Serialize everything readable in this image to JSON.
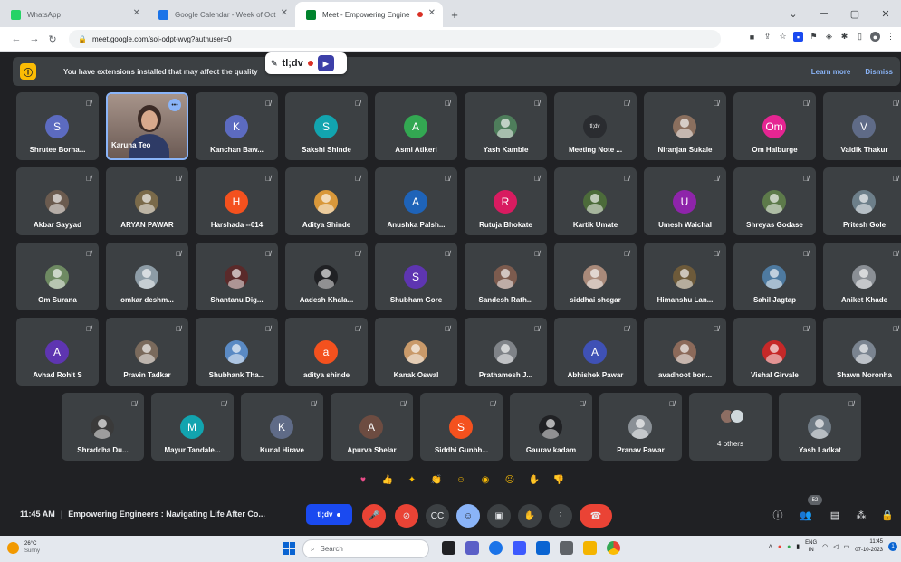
{
  "browser": {
    "tabs": [
      {
        "title": "WhatsApp",
        "favicon_color": "#25d366",
        "active": false
      },
      {
        "title": "Google Calendar - Week of Oct",
        "favicon_color": "#1a73e8",
        "active": false
      },
      {
        "title": "Meet - Empowering Engine",
        "favicon_color": "#00832d",
        "active": true
      }
    ],
    "new_tab": "+",
    "url": "meet.google.com/soi-odpt-wvg?authuser=0"
  },
  "banner": {
    "message": "You have extensions installed that may affect the quality",
    "learn_more": "Learn more",
    "dismiss": "Dismiss"
  },
  "tldv_overlay": {
    "label": "tl;dv"
  },
  "participants": [
    [
      {
        "name": "Shrutee Borha...",
        "initial": "S",
        "color": "#5c6bc0",
        "type": "initial"
      },
      {
        "name": "Karuna Teo",
        "type": "video",
        "self": true
      },
      {
        "name": "Kanchan Baw...",
        "initial": "K",
        "color": "#5c6bc0",
        "type": "initial"
      },
      {
        "name": "Sakshi Shinde",
        "initial": "S",
        "color": "#12a4af",
        "type": "initial"
      },
      {
        "name": "Asmi Atikeri",
        "initial": "A",
        "color": "#33a852",
        "type": "initial"
      },
      {
        "name": "Yash Kamble",
        "color": "#4e7d5b",
        "type": "photo"
      },
      {
        "name": "Meeting Note ...",
        "initial": "tl;dv",
        "color": "#2a2c30",
        "type": "initial"
      },
      {
        "name": "Niranjan Sukale",
        "color": "#8a6f5e",
        "type": "photo"
      },
      {
        "name": "Om Halburge",
        "initial": "Om",
        "color": "#e52592",
        "type": "initial"
      },
      {
        "name": "Vaidik Thakur",
        "initial": "V",
        "color": "#5f6b87",
        "type": "initial"
      }
    ],
    [
      {
        "name": "Akbar Sayyad",
        "color": "#6b5b4f",
        "type": "photo"
      },
      {
        "name": "ARYAN PAWAR",
        "color": "#7a6a4a",
        "type": "photo"
      },
      {
        "name": "Harshada --014",
        "initial": "H",
        "color": "#f4511e",
        "type": "initial"
      },
      {
        "name": "Aditya Shinde",
        "color": "#d9983a",
        "type": "photo"
      },
      {
        "name": "Anushka Palsh...",
        "initial": "A",
        "color": "#1e63b8",
        "type": "initial"
      },
      {
        "name": "Rutuja Bhokate",
        "initial": "R",
        "color": "#d81b60",
        "type": "initial"
      },
      {
        "name": "Kartik Umate",
        "color": "#4c6b3a",
        "type": "photo"
      },
      {
        "name": "Umesh Waichal",
        "initial": "U",
        "color": "#8e24aa",
        "type": "initial"
      },
      {
        "name": "Shreyas Godase",
        "color": "#5d7a4a",
        "type": "photo"
      },
      {
        "name": "Pritesh Gole",
        "color": "#6d7f8a",
        "type": "photo"
      }
    ],
    [
      {
        "name": "Om Surana",
        "color": "#6e8a62",
        "type": "photo"
      },
      {
        "name": "omkar deshm...",
        "color": "#8d9ca6",
        "type": "photo"
      },
      {
        "name": "Shantanu Dig...",
        "color": "#5a2a2a",
        "type": "photo"
      },
      {
        "name": "Aadesh Khala...",
        "color": "#202124",
        "type": "photo"
      },
      {
        "name": "Shubham Gore",
        "initial": "S",
        "color": "#5e35b1",
        "type": "initial"
      },
      {
        "name": "Sandesh Rath...",
        "color": "#7c5b4e",
        "type": "photo"
      },
      {
        "name": "siddhai shegar",
        "color": "#a98a7a",
        "type": "photo"
      },
      {
        "name": "Himanshu Lan...",
        "color": "#6d5a3a",
        "type": "photo"
      },
      {
        "name": "Sahil Jagtap",
        "color": "#4e7aa0",
        "type": "photo"
      },
      {
        "name": "Aniket Khade",
        "color": "#8a8f95",
        "type": "photo"
      }
    ],
    [
      {
        "name": "Avhad Rohit S",
        "initial": "A",
        "color": "#5e35b1",
        "type": "initial"
      },
      {
        "name": "Pravin Tadkar",
        "color": "#7a6a5c",
        "type": "photo"
      },
      {
        "name": "Shubhank Tha...",
        "color": "#5a8ac4",
        "type": "photo"
      },
      {
        "name": "aditya shinde",
        "initial": "a",
        "color": "#f4511e",
        "type": "initial"
      },
      {
        "name": "Kanak Oswal",
        "color": "#c99a6a",
        "type": "photo"
      },
      {
        "name": "Prathamesh J...",
        "color": "#7f8388",
        "type": "photo"
      },
      {
        "name": "Abhishek Pawar",
        "initial": "A",
        "color": "#3f51b5",
        "type": "initial"
      },
      {
        "name": "avadhoot bon...",
        "color": "#8c6a5a",
        "type": "photo"
      },
      {
        "name": "Vishal Girvale",
        "color": "#c62828",
        "type": "photo"
      },
      {
        "name": "Shawn Noronha",
        "color": "#7a8490",
        "type": "photo"
      }
    ],
    [
      {
        "name": "Shraddha Du...",
        "color": "#3a3a3a",
        "type": "photo"
      },
      {
        "name": "Mayur Tandale...",
        "initial": "M",
        "color": "#12a4af",
        "type": "initial"
      },
      {
        "name": "Kunal Hirave",
        "initial": "K",
        "color": "#5f6b87",
        "type": "initial"
      },
      {
        "name": "Apurva Shelar",
        "initial": "A",
        "color": "#6d4c41",
        "type": "initial"
      },
      {
        "name": "Siddhi Gunbh...",
        "initial": "S",
        "color": "#f4511e",
        "type": "initial"
      },
      {
        "name": "Gaurav kadam",
        "color": "#202124",
        "type": "photo"
      },
      {
        "name": "Pranav Pawar",
        "color": "#8a9096",
        "type": "photo"
      },
      {
        "name": "4 others",
        "type": "others"
      },
      {
        "name": "Yash Ladkat",
        "color": "#6f7a84",
        "type": "photo"
      }
    ]
  ],
  "reactions": [
    {
      "glyph": "♥",
      "color": "#ea4c89"
    },
    {
      "glyph": "👍",
      "color": "#fbbc04"
    },
    {
      "glyph": "✦",
      "color": "#fbbc04"
    },
    {
      "glyph": "👏",
      "color": "#fbbc04"
    },
    {
      "glyph": "☺",
      "color": "#fbbc04"
    },
    {
      "glyph": "◉",
      "color": "#fbbc04"
    },
    {
      "glyph": "☹",
      "color": "#fbbc04"
    },
    {
      "glyph": "✋",
      "color": "#fbbc04"
    },
    {
      "glyph": "👎",
      "color": "#fbbc04"
    }
  ],
  "meeting": {
    "time": "11:45 AM",
    "separator": "|",
    "title": "Empowering Engineers : Navigating Life After Co...",
    "tldv_button": "tl;dv",
    "participant_count": "52"
  },
  "taskbar": {
    "temperature": "26°C",
    "condition": "Sunny",
    "search_placeholder": "Search",
    "lang_top": "ENG",
    "lang_bottom": "IN",
    "clock_time": "11:45",
    "clock_date": "07-10-2023",
    "notification_count": "1"
  }
}
